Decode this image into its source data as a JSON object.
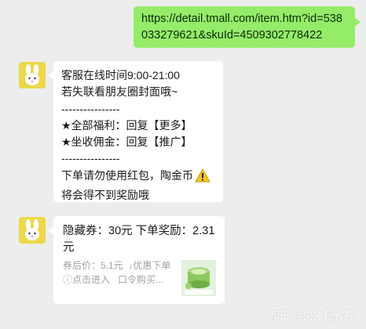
{
  "messages": {
    "sent_link": "https://detail.tmall.com/item.htm?id=538033279621&skuId=4509302778422",
    "reply1_lines": [
      "客服在线时间9:00-21:00",
      "若失联看朋友圈封面哦~",
      "----------------",
      "★全部福利：回复【更多】",
      "★坐收佣金：回复【推广】",
      "----------------",
      "下单请勿使用红包，陶金币",
      "将会得不到奖励哦"
    ],
    "reply2": {
      "headline": "隐藏券：30元  下单奖励：2.31元",
      "after_coupon": "券后价：5.1元",
      "discount": "↓优惠下单",
      "click_enter": "ⓘ点击进入",
      "password_buy": "口令购买..."
    }
  },
  "icons": {
    "avatar": "bunny-avatar-icon",
    "warning": "warning-icon",
    "product_thumb": "product-thumbnail"
  },
  "colors": {
    "sent_bubble": "#95ec69",
    "received_bubble": "#ffffff",
    "background": "#ededed",
    "avatar": "#ecd84a"
  },
  "watermark": "知乎 @兔兔超省券"
}
